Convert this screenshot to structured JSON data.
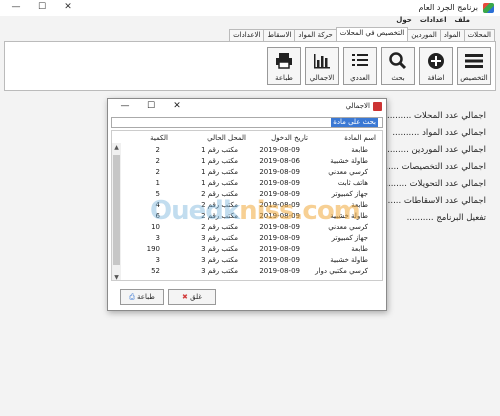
{
  "window": {
    "title": "برنامج الجرد العام"
  },
  "menu": [
    "ملف",
    "اعدادات",
    "حول"
  ],
  "tabs": [
    {
      "label": "المحلات"
    },
    {
      "label": "المواد"
    },
    {
      "label": "الموردين"
    },
    {
      "label": "التخصيص في المحلات",
      "active": true
    },
    {
      "label": "حركة المواد"
    },
    {
      "label": "الاسقاط"
    },
    {
      "label": "الاعدادات"
    }
  ],
  "toolbar": {
    "assign": "التخصيص",
    "add": "اضافة",
    "search": "بحث",
    "numeric": "العددي",
    "total": "الاجمالي",
    "print": "طباعة"
  },
  "stats": [
    "اجمالي عدد المحلات ..........",
    "اجمالي عدد المواد ..........",
    "اجمالي عدد الموردين ..........",
    "اجمالي عدد التخصيصات ..........",
    "اجمالي عدد التحويلات ..........",
    "اجمالي عدد الاسقاطات ..........",
    "تفعيل البرنامج .........."
  ],
  "dialog": {
    "title": "الاجمالي",
    "search_placeholder": "بحث على مادة",
    "columns": {
      "name": "اسم المادة",
      "date": "تاريخ الدخول",
      "location": "المحل الحالي",
      "qty": "الكمية"
    },
    "rows": [
      {
        "name": "طابعة",
        "date": "2019-08-09",
        "location": "مكتب رقم 1",
        "qty": "2"
      },
      {
        "name": "طاولة خشبية",
        "date": "2019-08-06",
        "location": "مكتب رقم 1",
        "qty": "2"
      },
      {
        "name": "كرسي معدني",
        "date": "2019-08-09",
        "location": "مكتب رقم 1",
        "qty": "2"
      },
      {
        "name": "هاتف ثابت",
        "date": "2019-08-09",
        "location": "مكتب رقم 1",
        "qty": "1"
      },
      {
        "name": "جهاز كمبيوتر",
        "date": "2019-08-09",
        "location": "مكتب رقم 2",
        "qty": "5"
      },
      {
        "name": "طابعة",
        "date": "2019-08-09",
        "location": "مكتب رقم 2",
        "qty": "4"
      },
      {
        "name": "طاولة خشبية",
        "date": "2019-08-09",
        "location": "مكتب رقم 2",
        "qty": "6"
      },
      {
        "name": "كرسي معدني",
        "date": "2019-08-09",
        "location": "مكتب رقم 2",
        "qty": "10"
      },
      {
        "name": "جهاز كمبيوتر",
        "date": "2019-08-09",
        "location": "مكتب رقم 3",
        "qty": "3"
      },
      {
        "name": "طابعة",
        "date": "2019-08-09",
        "location": "مكتب رقم 3",
        "qty": "190"
      },
      {
        "name": "طاولة خشبية",
        "date": "2019-08-09",
        "location": "مكتب رقم 3",
        "qty": "3"
      },
      {
        "name": "كرسي مكتبي دوار",
        "date": "2019-08-09",
        "location": "مكتب رقم 3",
        "qty": "52"
      }
    ],
    "close_label": "غلق",
    "print_label": "طباعة"
  },
  "watermark": {
    "part1": "Ouedk",
    "part2": "niss.com"
  },
  "colors": {
    "accent": "#3a78d4",
    "close_red": "#d23c3c"
  }
}
